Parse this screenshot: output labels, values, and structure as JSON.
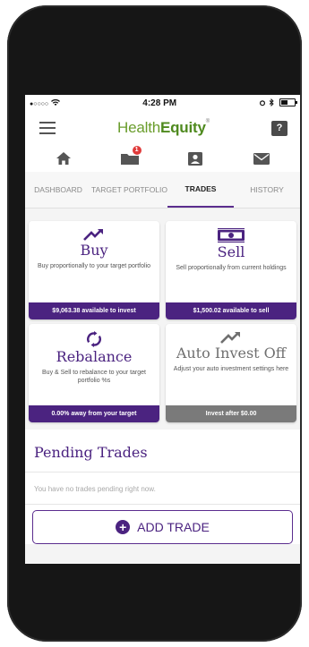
{
  "status": {
    "signal": "●○○○○",
    "time": "4:28 PM"
  },
  "header": {
    "brand_a": "Health",
    "brand_b": "Equity",
    "help": "?"
  },
  "iconbar": {
    "badge": "1"
  },
  "tabs": [
    {
      "label": "DASHBOARD"
    },
    {
      "label": "TARGET PORTFOLIO"
    },
    {
      "label": "TRADES"
    },
    {
      "label": "HISTORY"
    }
  ],
  "cards": {
    "buy": {
      "title": "Buy",
      "desc": "Buy proportionally to your target portfolio",
      "foot": "$9,063.38 available to invest",
      "icon": "trending-up-icon"
    },
    "sell": {
      "title": "Sell",
      "desc": "Sell proportionally from current holdings",
      "foot": "$1,500.02 available to sell",
      "icon": "cash-icon"
    },
    "rebalance": {
      "title": "Rebalance",
      "desc": "Buy & Sell to rebalance to your target portfolio %s",
      "foot": "0.00% away from your target",
      "icon": "sync-icon"
    },
    "auto": {
      "title": "Auto Invest Off",
      "desc": "Adjust your auto investment settings here",
      "foot": "Invest after $0.00",
      "icon": "trending-up-icon"
    }
  },
  "pending": {
    "title": "Pending Trades",
    "empty": "You have no trades pending right now.",
    "add_label": "ADD TRADE"
  },
  "colors": {
    "brand_purple": "#4b2380",
    "brand_green": "#6a9d2c",
    "badge_red": "#e03b3b"
  }
}
